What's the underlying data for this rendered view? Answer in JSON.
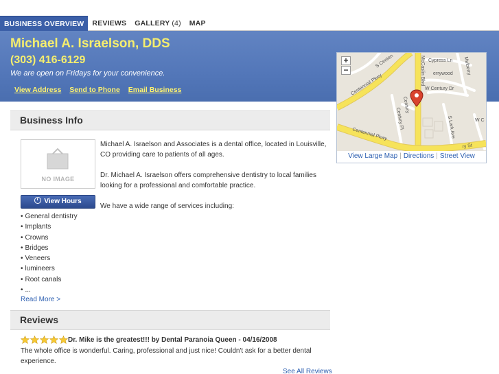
{
  "tabs": [
    {
      "label": "BUSINESS OVERVIEW",
      "count": ""
    },
    {
      "label": "REVIEWS",
      "count": ""
    },
    {
      "label": "GALLERY",
      "count": "(4)"
    },
    {
      "label": "MAP",
      "count": ""
    }
  ],
  "business": {
    "name": "Michael A. Israelson, DDS",
    "phone": "(303) 416-6129",
    "tagline": "We are open on Fridays for your convenience."
  },
  "action_links": {
    "view_address": "View Address",
    "send_to_phone": "Send to Phone",
    "email_business": "Email Business"
  },
  "map": {
    "zoom_in": "+",
    "zoom_out": "−",
    "streets": {
      "cypress": "Cypress Ln",
      "cherrywood": "errywood",
      "century_dr": "W Century Dr",
      "centennial_1": "Centennial Pkwy",
      "centennial_2": "Centennial Pkwy",
      "s_centennial": "S Centen",
      "mccaslin": "McCaslin Blvd",
      "century_pl": "Century Pl",
      "lark": "S Lark Ave",
      "century_short": "Century",
      "mulberry": "Mulberry",
      "wc": "W C",
      "ry_st": "ry St"
    },
    "links": {
      "large": "View Large Map",
      "directions": "Directions",
      "street": "Street View"
    },
    "accent": "#f6e35a"
  },
  "info": {
    "heading": "Business Info",
    "no_image": "NO IMAGE",
    "view_hours": "View Hours",
    "description": [
      "Michael A. Israelson and Associates is a dental office, located in Louisville, CO providing care to patients of all ages.",
      "Dr. Michael A. Israelson offers comprehensive dentistry to local families looking for a professional and comfortable practice.",
      "We have a wide range of services including:"
    ],
    "services": [
      "General dentistry",
      "Implants",
      "Crowns",
      "Bridges",
      "Veneers",
      "lumineers",
      "Root canals",
      "..."
    ],
    "read_more": "Read More >"
  },
  "reviews": {
    "heading": "Reviews",
    "rating": 5,
    "items": [
      {
        "title": "Dr. Mike is the greatest!!! by Dental Paranoia Queen - 04/16/2008",
        "body": "The whole office is wonderful. Caring, professional and just nice! Couldn't ask for a better dental experience."
      }
    ],
    "see_all": "See All Reviews"
  },
  "colors": {
    "banner": "#5377b9",
    "tab_active": "#3b5fa8",
    "name_yellow": "#f5ee6e",
    "link_blue": "#2a5db0"
  }
}
